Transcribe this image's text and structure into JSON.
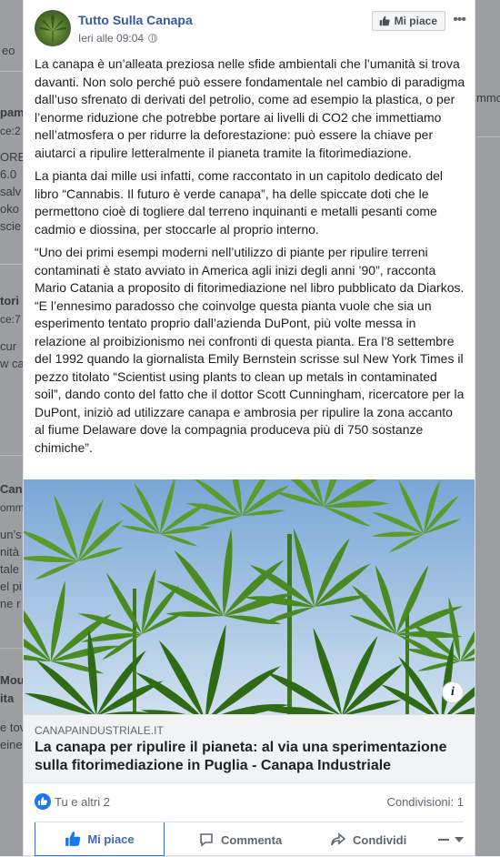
{
  "post": {
    "page_name": "Tutto Sulla Canapa",
    "timestamp": "Ieri alle 09:04",
    "like_page_label": "Mi piace",
    "paragraphs": [
      "La canapa è un’alleata preziosa nelle sfide ambientali che l’umanità si trova davanti. Non solo perché può essere fondamentale nel cambio di paradigma dall’uso sfrenato di derivati del petrolio, come ad esempio la plastica, o per l’enorme riduzione che potrebbe portare ai livelli di CO2 che immettiamo nell’atmosfera o per ridurre la deforestazione: può essere la chiave per aiutarci a ripulire letteralmente il pianeta tramite la fitorimediazione.",
      "La pianta dai mille usi infatti, come raccontato in un capitolo dedicato del libro “Cannabis. Il futuro è verde canapa”, ha delle spiccate doti che le permettono cioè di togliere dal terreno inquinanti e metalli pesanti come cadmio e diossina, per stoccarle al proprio interno.",
      "“Uno dei primi esempi moderni nell’utilizzo di piante per ripulire terreni contaminati è stato avviato in America agli inizi degli anni ’90”, racconta Mario Catania a proposito di fitorimediazione nel libro pubblicato da Diarkos. “E l’ennesimo paradosso che coinvolge questa pianta vuole che sia un esperimento tentato proprio dall’azienda DuPont, più volte messa in relazione al proibizionismo nei confronti di questa pianta. Era l’8 settembre del 1992 quando la giornalista Emily Bernstein scrisse sul New York Times il pezzo titolato “Scientist using plants to clean up metals in contaminated soil”, dando conto del fatto che il dottor Scott Cunningham, ricercatore per la DuPont, iniziò ad utilizzare canapa e ambrosia per ripulire la zona accanto al fiume Delaware dove la compagnia produceva più di 750 sostanze chimiche”."
    ],
    "link": {
      "domain": "CANAPAINDUSTRIALE.IT",
      "title": "La canapa per ripulire il pianeta: al via una sperimentazione sulla fitorimediazione in Puglia - Canapa Industriale",
      "info_label": "i"
    },
    "stats": {
      "likes": "Tu e altri 2",
      "shares": "Condivisioni: 1"
    },
    "actions": {
      "like": "Mi piace",
      "comment": "Commenta",
      "share": "Condividi"
    }
  },
  "background": {
    "fragments": [
      "eo",
      "pam",
      "ce:2",
      "ORE",
      "6.0",
      "salv",
      "oko",
      "scie",
      "tori",
      "ce:7",
      "cur",
      "w ca",
      "Cana",
      "omm",
      "un’s",
      "nità",
      "tale",
      "el pi",
      "ne r",
      "Mou",
      "ita",
      "e tov",
      "eine",
      "mmc"
    ]
  },
  "colors": {
    "link_blue": "#385898",
    "facebook_blue": "#1877f2",
    "backdrop": "#9c9ea2"
  }
}
